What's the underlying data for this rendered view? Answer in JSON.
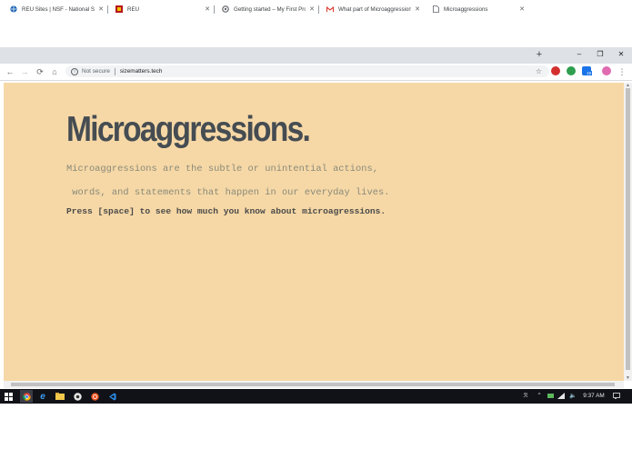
{
  "browser": {
    "tabs": [
      {
        "title": "REU Sites | NSF - National Science Foundation",
        "favicon": "nsf-globe-icon",
        "active": false
      },
      {
        "title": "REU",
        "favicon": "reu-logo-icon",
        "active": false
      },
      {
        "title": "Getting started – My First Project",
        "favicon": "gear-icon",
        "active": false
      },
      {
        "title": "What part of Microaggressions",
        "favicon": "gmail-icon",
        "active": false
      },
      {
        "title": "Microaggressions",
        "favicon": "document-icon",
        "active": true
      }
    ],
    "new_tab_symbol": "+",
    "window_controls": {
      "minimize": "–",
      "maximize": "❐",
      "close": "✕"
    },
    "nav": {
      "back": "←",
      "forward": "→",
      "reload": "⟳",
      "home": "⌂"
    },
    "address": {
      "security_label": "Not secure",
      "url": "sizematters.tech",
      "info_symbol": "i",
      "star_symbol": "☆"
    },
    "extension_badge": "19",
    "menu_symbol": "⋮"
  },
  "page": {
    "headline": "Microaggressions.",
    "subtitle_line1": "Microaggressions are the subtle or unintential actions,",
    "subtitle_line2": " words, and statements that happen in our everyday lives.",
    "prompt": "Press [space] to see how much you know about microagressions."
  },
  "taskbar": {
    "clock": "9:37 AM",
    "tray_symbols": {
      "people": "ℛ",
      "chevron": "⌃",
      "language": "ENG",
      "volume": "🔈"
    },
    "apps": [
      "windows-start-icon",
      "chrome-icon",
      "edge-icon",
      "file-explorer-icon",
      "app-icon",
      "ubuntu-icon",
      "vscode-icon"
    ]
  },
  "colors": {
    "page_background": "#f6d8a6",
    "headline": "#454c52",
    "subtitle": "#8a8a7a",
    "prompt": "#4a4a4a",
    "taskbar": "#101218"
  }
}
